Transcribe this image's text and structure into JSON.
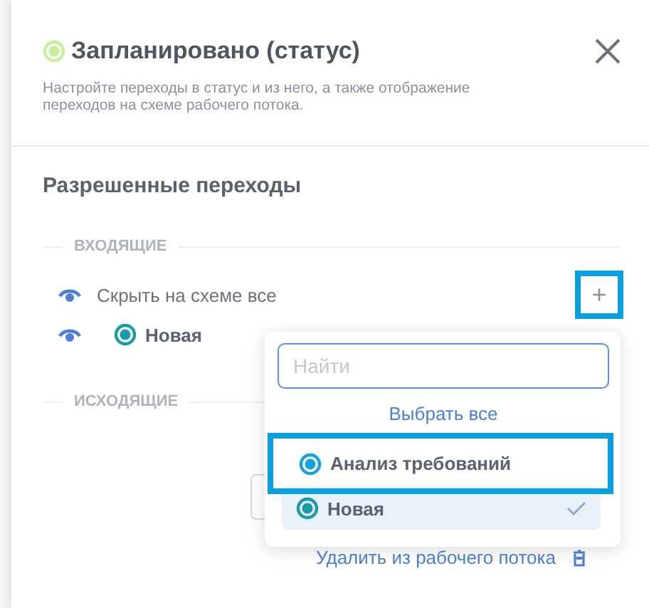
{
  "header": {
    "color": "#c5ef9a",
    "title": "Запланировано (статус)",
    "description": "Настройте переходы в статус и из него, а также отображение переходов на схеме рабочего потока."
  },
  "section_title": "Разрешенные переходы",
  "incoming": {
    "label": "ВХОДЯЩИЕ",
    "hide_all": {
      "label": "Скрыть на схеме все"
    },
    "add_button": {
      "label": "+",
      "highlighted": true
    },
    "transitions": [
      {
        "name": "Новая",
        "color": "#1b9aa8"
      }
    ]
  },
  "outgoing": {
    "label": "ИСХОДЯЩИЕ"
  },
  "dropdown": {
    "search": {
      "placeholder": "Найти"
    },
    "select_all": "Выбрать все",
    "options": [
      {
        "name": "Анализ требований",
        "color": "#15a2e0",
        "selected": false,
        "highlighted": true
      },
      {
        "name": "Новая",
        "color": "#1b9aa8",
        "selected": true,
        "highlighted": false
      }
    ]
  },
  "delete_link": "Удалить из рабочего потока"
}
